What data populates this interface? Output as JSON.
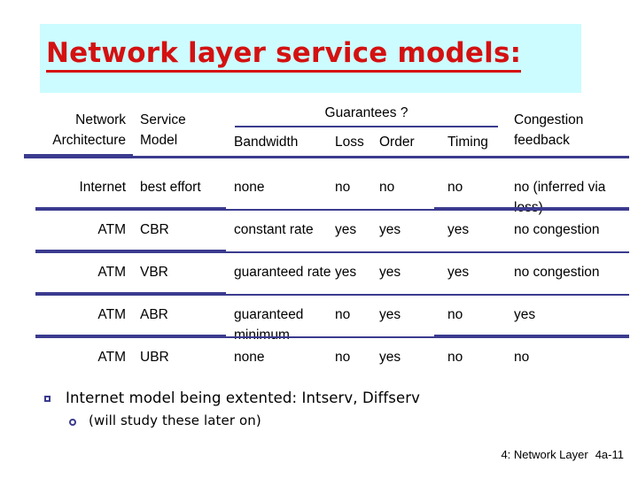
{
  "slide": {
    "title": "Network layer service models:",
    "title_color": "#d41111",
    "banner_color": "#ccfcff",
    "rule_color": "#3b3b8f"
  },
  "table": {
    "header": {
      "col1_line1": "Network",
      "col1_line2": "Architecture",
      "col2_line1": "Service",
      "col2_line2": "Model",
      "group_label": "Guarantees ?",
      "sub_bandwidth": "Bandwidth",
      "sub_loss": "Loss",
      "sub_order": "Order",
      "sub_timing": "Timing",
      "col7_line1": "Congestion",
      "col7_line2": "feedback"
    },
    "rows": [
      {
        "architecture": "Internet",
        "model": "best effort",
        "bandwidth": "none",
        "loss": "no",
        "order": "no",
        "timing": "no",
        "congestion": "no (inferred via loss)"
      },
      {
        "architecture": "ATM",
        "model": "CBR",
        "bandwidth": "constant rate",
        "loss": "yes",
        "order": "yes",
        "timing": "yes",
        "congestion": "no congestion"
      },
      {
        "architecture": "ATM",
        "model": "VBR",
        "bandwidth": "guaranteed rate",
        "loss": "yes",
        "order": "yes",
        "timing": "yes",
        "congestion": "no congestion"
      },
      {
        "architecture": "ATM",
        "model": "ABR",
        "bandwidth": "guaranteed minimum",
        "loss": "no",
        "order": "yes",
        "timing": "no",
        "congestion": "yes"
      },
      {
        "architecture": "ATM",
        "model": "UBR",
        "bandwidth": "none",
        "loss": "no",
        "order": "yes",
        "timing": "no",
        "congestion": "no"
      }
    ]
  },
  "bullets": {
    "level1": "Internet model being extented: Intserv, Diffserv",
    "level2": "(will study these later on)"
  },
  "footer": {
    "chapter": "4: Network Layer",
    "page": "4a-11"
  }
}
